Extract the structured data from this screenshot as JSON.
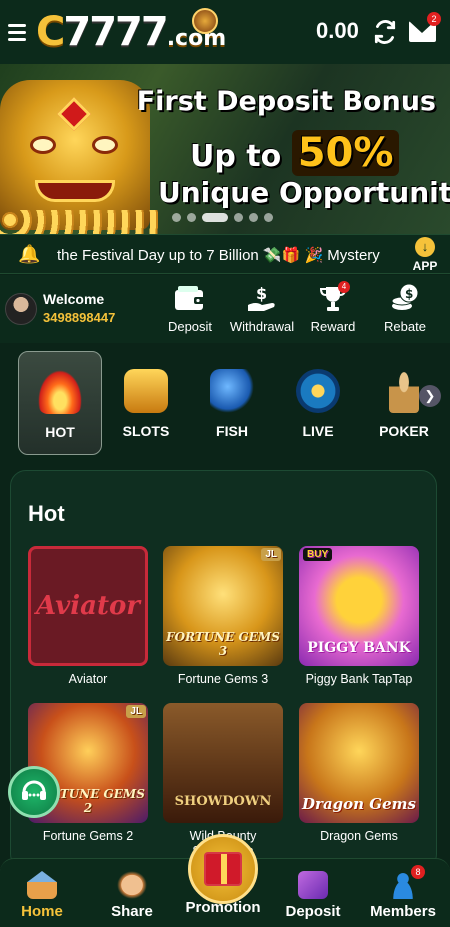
{
  "header": {
    "logo_main": "C",
    "logo_digits": "7777",
    "logo_suffix": ".com",
    "balance": "0.00",
    "mail_badge": "2"
  },
  "banner": {
    "line1": "First Deposit Bonus",
    "line2_prefix": "Up to",
    "line2_percent": "50%",
    "line3": "Unique Opportunity",
    "slides": 6,
    "active_slide": 3
  },
  "marquee": {
    "text": "the Festival Day up to 7 Billion 💸🎁    🎉 Mystery",
    "app_label": "APP"
  },
  "user": {
    "welcome": "Welcome",
    "phone": "3498898447"
  },
  "actions": [
    {
      "label": "Deposit",
      "icon": "wallet-icon"
    },
    {
      "label": "Withdrawal",
      "icon": "cash-hand-icon"
    },
    {
      "label": "Reward",
      "icon": "trophy-icon",
      "badge": "4"
    },
    {
      "label": "Rebate",
      "icon": "coins-stack-icon"
    }
  ],
  "categories": [
    {
      "label": "HOT",
      "icon": "flame-icon",
      "active": true
    },
    {
      "label": "SLOTS",
      "icon": "slots-777-icon"
    },
    {
      "label": "FISH",
      "icon": "shark-icon"
    },
    {
      "label": "LIVE",
      "icon": "roulette-icon"
    },
    {
      "label": "POKER",
      "icon": "chess-pawn-icon"
    }
  ],
  "hot": {
    "title": "Hot",
    "games": [
      {
        "name": "Aviator",
        "art": "Aviator"
      },
      {
        "name": "Fortune Gems 3",
        "art": "FORTUNE GEMS 3",
        "tag": "JL"
      },
      {
        "name": "Piggy Bank TapTap",
        "art": "PIGGY BANK",
        "tag": "BUY"
      },
      {
        "name": "Fortune Gems 2",
        "art": "FORTUNE GEMS 2",
        "tag": "JL"
      },
      {
        "name": "Wild Bounty Showdown",
        "art": "SHOWDOWN"
      },
      {
        "name": "Dragon Gems",
        "art": "Dragon Gems"
      }
    ]
  },
  "nav": {
    "items": [
      {
        "label": "Home",
        "active": true
      },
      {
        "label": "Share"
      },
      {
        "label": "Promotion"
      },
      {
        "label": "Deposit"
      },
      {
        "label": "Members",
        "badge": "8"
      }
    ]
  },
  "colors": {
    "accent": "#f5c23a",
    "background": "#0b2418",
    "badge": "#e02020"
  }
}
